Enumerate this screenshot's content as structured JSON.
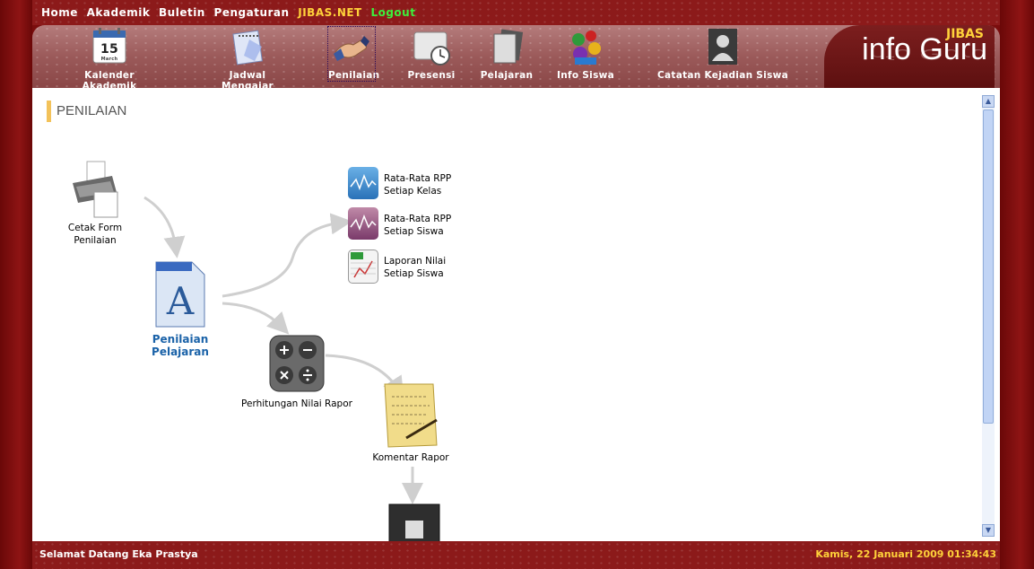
{
  "top_menu": {
    "home": "Home",
    "akademik": "Akademik",
    "buletin": "Buletin",
    "pengaturan": "Pengaturan",
    "jibas_net": "JIBAS.NET",
    "logout": "Logout"
  },
  "toolbar": {
    "items": [
      {
        "label": "Kalender Akademik",
        "icon": "calendar-icon"
      },
      {
        "label": "Jadwal Mengajar",
        "icon": "notepad-icon"
      },
      {
        "label": "Penilaian",
        "icon": "handshake-icon"
      },
      {
        "label": "Presensi",
        "icon": "clock-icon"
      },
      {
        "label": "Pelajaran",
        "icon": "documents-icon"
      },
      {
        "label": "Info Siswa",
        "icon": "students-icon"
      },
      {
        "label": "Catatan Kejadian Siswa",
        "icon": "user-silhouette-icon"
      }
    ],
    "active_item": "Penilaian",
    "calendar_day": "15",
    "calendar_month": "March"
  },
  "brand": {
    "jibas": "JIBAS",
    "title": "info Guru"
  },
  "page": {
    "title": "PENILAIAN"
  },
  "flow": {
    "cetak_form": [
      "Cetak Form",
      "Penilaian"
    ],
    "penilaian_pelajaran": "Penilaian Pelajaran",
    "rata_rpp_kelas": [
      "Rata-Rata RPP",
      "Setiap Kelas"
    ],
    "rata_rpp_siswa": [
      "Rata-Rata RPP",
      "Setiap Siswa"
    ],
    "laporan_nilai": [
      "Laporan Nilai",
      "Setiap Siswa"
    ],
    "perhitungan": "Perhitungan Nilai Rapor",
    "komentar": "Komentar Rapor"
  },
  "status": {
    "welcome": "Selamat Datang Eka Prastya",
    "clock": "Kamis, 22 Januari 2009 01:34:43"
  },
  "colors": {
    "frame": "#8c1a1a",
    "accent": "#ffd23a",
    "link": "#1a62a8"
  }
}
